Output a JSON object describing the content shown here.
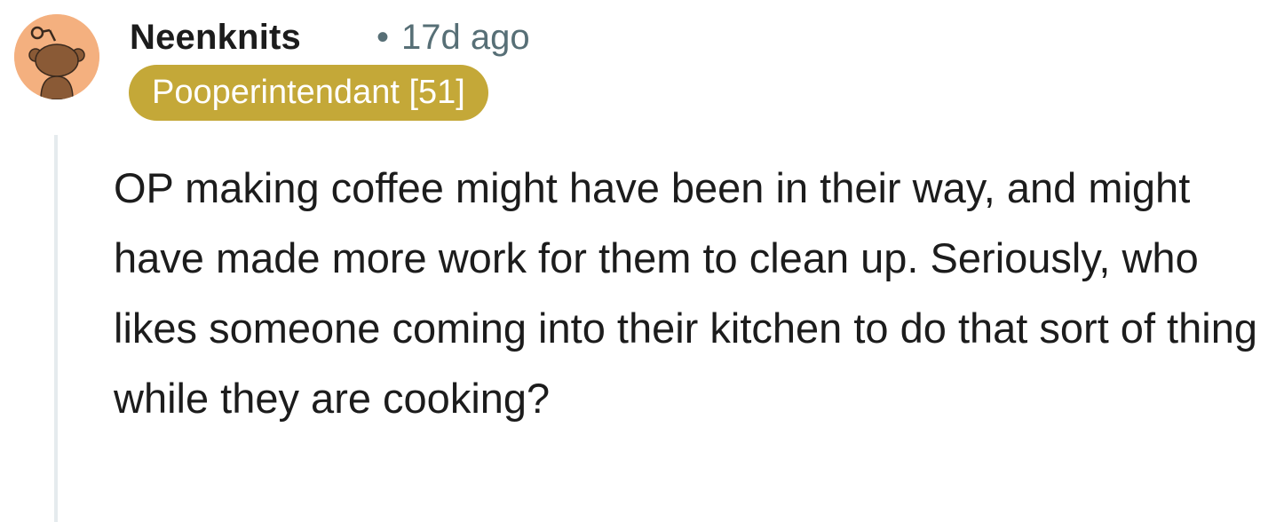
{
  "comment": {
    "username": "Neenknits",
    "separator": "•",
    "timestamp": "17d ago",
    "flair": "Pooperintendant [51]",
    "body": "OP making coffee might have been in their way, and might have made more work for them to clean up. Seriously, who likes someone coming into their kitchen to do that sort of thing while they are cooking?"
  },
  "avatar": {
    "icon": "snoo-avatar-icon",
    "background_color": "#f4b07f",
    "figure_color": "#8a5a36"
  },
  "colors": {
    "flair_background": "#c4a838",
    "meta_text": "#576f76",
    "thread_line": "#e5ebee"
  }
}
